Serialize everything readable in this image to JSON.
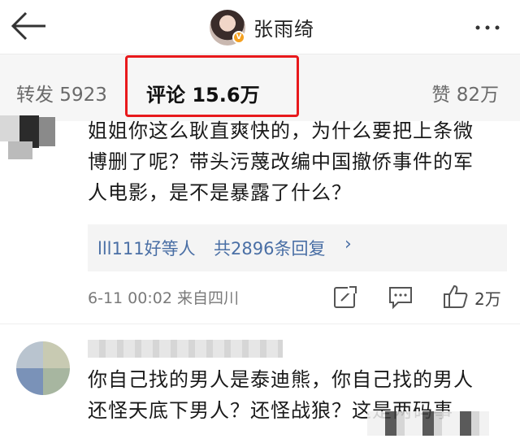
{
  "header": {
    "user_name": "张雨绮",
    "verified_badge": "V"
  },
  "tabs": {
    "repost": "转发 5923",
    "comment": "评论 15.6万",
    "like": "赞 82万"
  },
  "comments": [
    {
      "text_line1": "姐姐你这么耿直爽快的，为什么要把上条微",
      "text_line2": "博删了呢？带头污蔑改编中国撤侨事件的军",
      "text_line3": "人电影，是不是暴露了什么？",
      "replies": {
        "names": "lll111好等人",
        "count": "共2896条回复",
        "chevron": "›"
      },
      "meta": "6-11 00:02 来自四川",
      "like_count": "2万"
    },
    {
      "text_line1": "你自己找的男人是泰迪熊，你自己找的男人",
      "text_line2": "还怪天底下男人？还怪战狼？这是两码事"
    }
  ],
  "colors": {
    "highlight_box": "#e8191c",
    "link": "#4a6fa5",
    "badge": "#f4a020"
  }
}
